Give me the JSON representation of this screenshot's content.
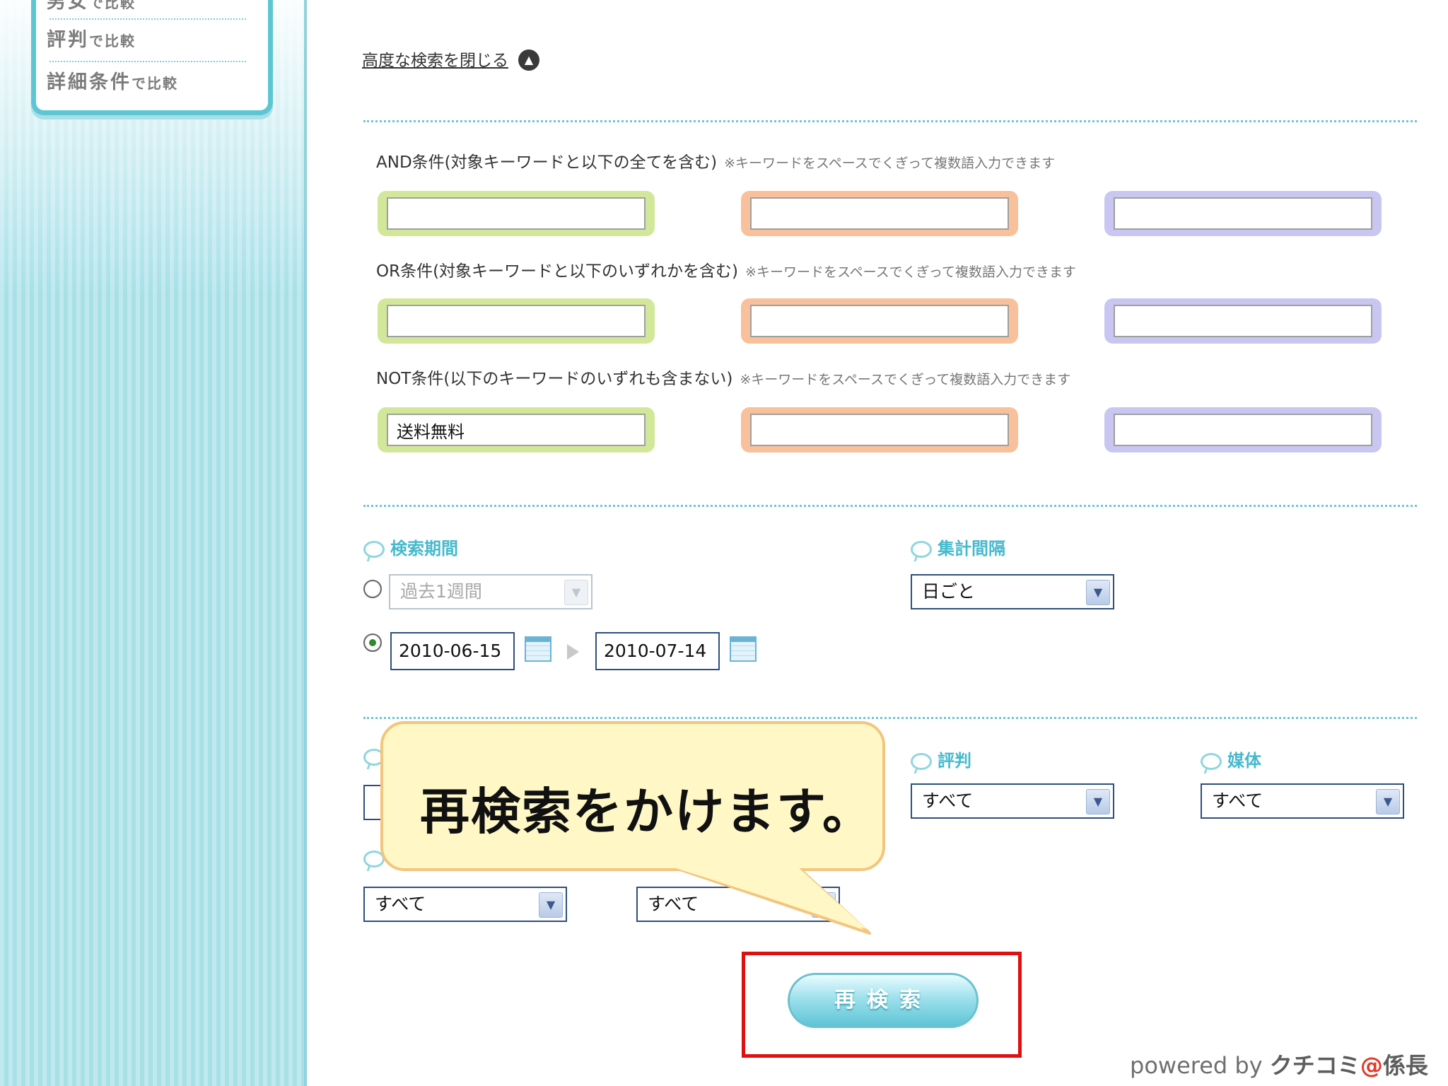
{
  "sidebar": {
    "compare_items": [
      {
        "main": "男女",
        "suffix": "で比較"
      },
      {
        "main": "評判",
        "suffix": "で比較"
      },
      {
        "main": "詳細条件",
        "suffix": "で比較"
      }
    ]
  },
  "advanced": {
    "close_label": "高度な検索を閉じる"
  },
  "conditions": [
    {
      "label": "AND条件(対象キーワードと以下の全てを含む)",
      "note": "※キーワードをスペースでくぎって複数語入力できます",
      "values": [
        "",
        "",
        ""
      ]
    },
    {
      "label": "OR条件(対象キーワードと以下のいずれかを含む)",
      "note": "※キーワードをスペースでくぎって複数語入力できます",
      "values": [
        "",
        "",
        ""
      ]
    },
    {
      "label": "NOT条件(以下のキーワードのいずれも含まない)",
      "note": "※キーワードをスペースでくぎって複数語入力できます",
      "values": [
        "送料無料",
        "",
        ""
      ]
    }
  ],
  "period": {
    "title": "検索期間",
    "preset_value": "過去1週間",
    "date_from": "2010-06-15",
    "date_to": "2010-07-14",
    "selected": "custom"
  },
  "interval": {
    "title": "集計間隔",
    "value": "日ごと"
  },
  "filters": {
    "reputation_title": "評判",
    "reputation_value": "すべて",
    "media_title": "媒体",
    "media_value": "すべて",
    "row2_left_value": "すべて",
    "row2_right_value": "すべて"
  },
  "callout": {
    "text": "再検索をかけます。"
  },
  "search_button": {
    "label": "再検索"
  },
  "footer": {
    "powered": "powered by",
    "brand_pre": "クチコミ",
    "brand_at": "@",
    "brand_post": "係長"
  },
  "colors": {
    "accent": "#46b9cd",
    "highlight": "#e01010",
    "and_box": "#d3e79b",
    "or_box": "#f8c09b",
    "not_box": "#c9c6f1"
  }
}
